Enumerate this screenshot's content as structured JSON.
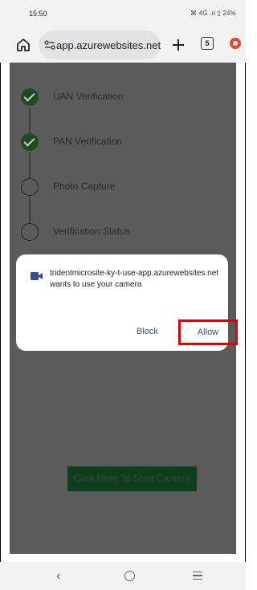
{
  "status_bar": {
    "time": "15:50",
    "indicators": "⌘ 4G .ıl ▯ 24%"
  },
  "toolbar": {
    "url": "app.azurewebsites.net",
    "tab_count": "5",
    "icons": {
      "home": "home-icon",
      "site_info": "tune-icon",
      "new_tab": "plus-icon",
      "menu": "browser-menu-icon"
    }
  },
  "page": {
    "steps": [
      {
        "label": "UAN Verification",
        "status": "done"
      },
      {
        "label": "PAN Verification",
        "status": "done"
      },
      {
        "label": "Photo Capture",
        "status": "pending"
      },
      {
        "label": "Verification Status",
        "status": "pending"
      }
    ],
    "camera_button": "Click Here To Start Camera"
  },
  "dialog": {
    "message": "tridentmicrosite-ky-t-use-app.azurewebsites.net wants to use your camera",
    "block_label": "Block",
    "allow_label": "Allow",
    "icon": "video-camera-icon",
    "highlight_color": "#e10000"
  },
  "navbar": {
    "back": "‹",
    "home": "home-circle-icon",
    "recents": "recents-icon"
  }
}
